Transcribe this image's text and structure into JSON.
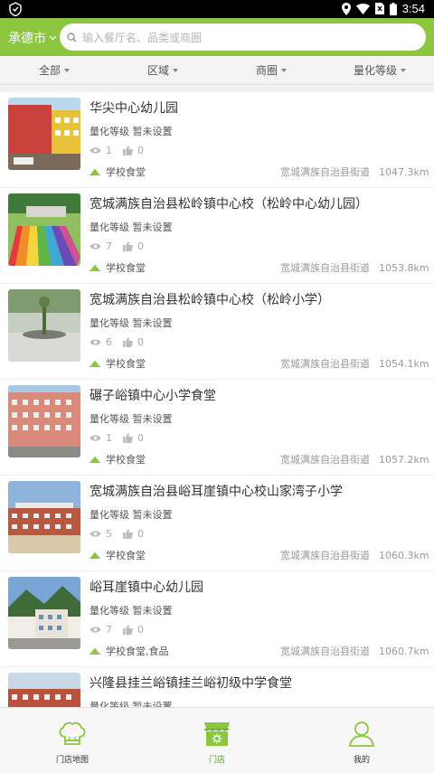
{
  "status_bar": {
    "time": "3:54"
  },
  "header": {
    "city": "承德市",
    "search_placeholder": "输入餐厅名、品类或商圈"
  },
  "filters": [
    {
      "label": "全部"
    },
    {
      "label": "区域"
    },
    {
      "label": "商圈"
    },
    {
      "label": "量化等级"
    }
  ],
  "stores": [
    {
      "name": "华尖中心幼儿园",
      "grade": "量化等级  暂未设置",
      "views": "1",
      "likes": "0",
      "category": "学校食堂",
      "area": "宽城满族自治县街道",
      "distance": "1047.3km"
    },
    {
      "name": "宽城满族自治县松岭镇中心校（松岭中心幼儿园）",
      "grade": "量化等级  暂未设置",
      "views": "7",
      "likes": "0",
      "category": "学校食堂",
      "area": "宽城满族自治县街道",
      "distance": "1053.8km"
    },
    {
      "name": "宽城满族自治县松岭镇中心校（松岭小学）",
      "grade": "量化等级  暂未设置",
      "views": "6",
      "likes": "0",
      "category": "学校食堂",
      "area": "宽城满族自治县街道",
      "distance": "1054.1km"
    },
    {
      "name": "碾子峪镇中心小学食堂",
      "grade": "量化等级  暂未设置",
      "views": "1",
      "likes": "0",
      "category": "学校食堂",
      "area": "宽城满族自治县街道",
      "distance": "1057.2km"
    },
    {
      "name": "宽城满族自治县峪耳崖镇中心校山家湾子小学",
      "grade": "量化等级  暂未设置",
      "views": "5",
      "likes": "0",
      "category": "学校食堂",
      "area": "宽城满族自治县街道",
      "distance": "1060.3km"
    },
    {
      "name": "峪耳崖镇中心幼儿园",
      "grade": "量化等级  暂未设置",
      "views": "7",
      "likes": "0",
      "category": "学校食堂,食品",
      "area": "宽城满族自治县街道",
      "distance": "1060.7km"
    },
    {
      "name": "兴隆县挂兰峪镇挂兰峪初级中学食堂",
      "grade": "量化等级  暂未设置",
      "views": "",
      "likes": "",
      "category": "",
      "area": "",
      "distance": ""
    }
  ],
  "tabbar": [
    {
      "label": "门店地图",
      "icon": "chef-hat-icon"
    },
    {
      "label": "门店",
      "icon": "storefront-icon"
    },
    {
      "label": "我的",
      "icon": "user-icon"
    }
  ],
  "colors": {
    "brand_green": "#8cc63f",
    "active_tab": "#5aa12f",
    "category_icon": "#8cc63f"
  }
}
